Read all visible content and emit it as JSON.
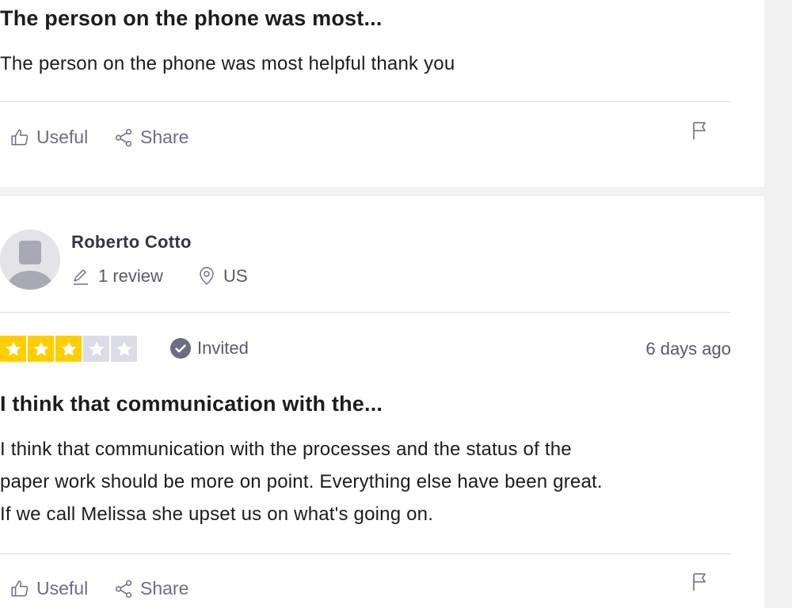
{
  "review1": {
    "title": "The person on the phone was most...",
    "body": "The person on the phone was most helpful thank you",
    "actions": {
      "useful_label": "Useful",
      "share_label": "Share"
    }
  },
  "review2": {
    "author": {
      "name": "Roberto Cotto",
      "review_count": "1 review",
      "country": "US"
    },
    "rating": {
      "stars": 3,
      "max": 5,
      "filled_color": "#ffce00",
      "empty_color": "#dcdce6"
    },
    "invited_label": "Invited",
    "date": "6 days ago",
    "title": "I think that communication with the...",
    "body_lines": [
      "I think that communication with the processes and the status of the",
      "paper work should be more on point. Everything else have been great.",
      "If we call Melissa she upset us on what's going on."
    ],
    "actions": {
      "useful_label": "Useful",
      "share_label": "Share"
    }
  },
  "icons": [
    "thumbs-up-icon",
    "share-icon",
    "flag-icon",
    "pencil-icon",
    "location-pin-icon",
    "check-badge-icon",
    "star-icon"
  ]
}
